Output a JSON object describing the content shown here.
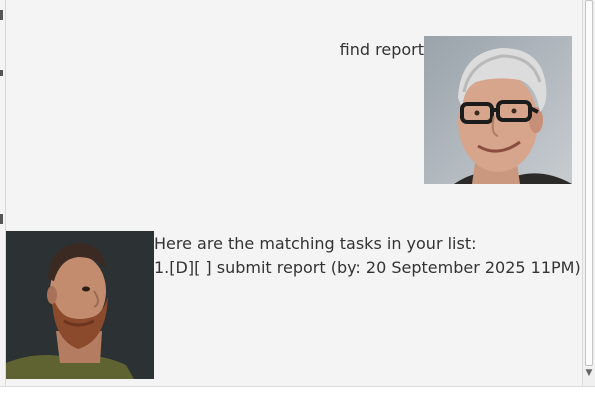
{
  "messages": {
    "user": {
      "text": "find report",
      "avatar_icon": "user-avatar-glasses"
    },
    "bot": {
      "line1": "Here are the matching tasks in your list:",
      "line2": "1.[D][ ] submit report (by: 20 September 2025 11PM)",
      "avatar_icon": "bot-avatar-bearded"
    }
  },
  "scrollbar": {
    "down_arrow_icon": "chevron-down-icon"
  },
  "colors": {
    "background": "#f4f4f4",
    "text": "#333333"
  }
}
